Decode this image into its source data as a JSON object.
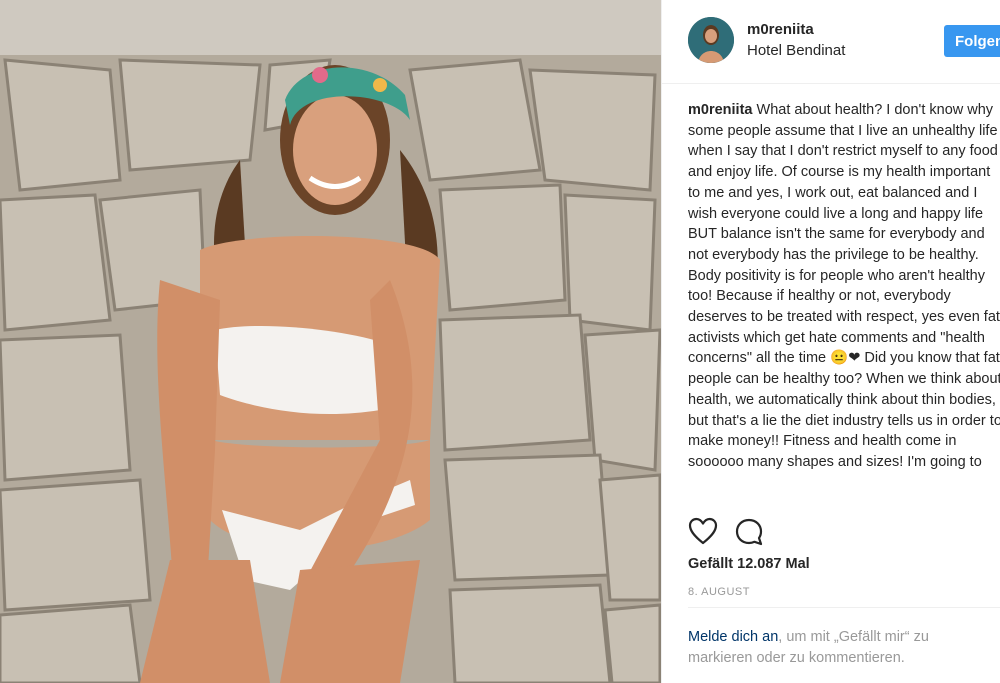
{
  "post": {
    "image_alt": "woman in white bikini and floral headband smiling in front of a stone wall"
  },
  "header": {
    "username": "m0reniita",
    "location": "Hotel Bendinat",
    "follow_label": "Folgen"
  },
  "caption": {
    "username": "m0reniita",
    "text": "What about health? I don't know why some people assume that I live an unhealthy life when I say that I don't restrict myself to any food and enjoy life. Of course is my health important to me and yes, I work out, eat balanced and I wish everyone could live a long and happy life BUT balance isn't the same for everybody and not everybody has the privilege to be healthy. Body positivity is for people who aren't healthy too! Because if healthy or not, everybody deserves to be treated with respect, yes even fat activists which get hate comments and \"health concerns\" all the time 😐❤ Did you know that fat people can be healthy too? When we think about health, we automatically think about thin bodies, but that's a lie the diet industry tells us in order to make money!! Fitness and health come in soooooo many shapes and sizes! I'm going to"
  },
  "actions": {
    "like_icon": "heart-outline-icon",
    "comment_icon": "speech-bubble-icon"
  },
  "likes": "Gefällt 12.087 Mal",
  "date": "8. AUGUST",
  "login": {
    "link": "Melde dich an",
    "rest": ", um mit „Gefällt mir“ zu markieren oder zu kommentieren."
  }
}
